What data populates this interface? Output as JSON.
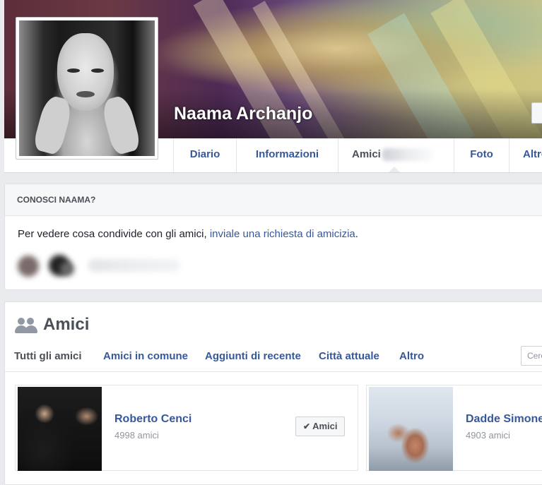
{
  "profile": {
    "name": "Naama Archanjo"
  },
  "tabs": [
    {
      "label": "Diario"
    },
    {
      "label": "Informazioni"
    },
    {
      "label": "Amici"
    },
    {
      "label": "Foto"
    },
    {
      "label": "Altro"
    }
  ],
  "conosci": {
    "heading": "CONOSCI NAAMA?",
    "text": "Per vedere cosa condivide con gli amici, ",
    "link": "inviale una richiesta di amicizia",
    "suffix": "."
  },
  "friends_section": {
    "title": "Amici",
    "subtabs": [
      {
        "label": "Tutti gli amici"
      },
      {
        "label": "Amici in comune"
      },
      {
        "label": "Aggiunti di recente"
      },
      {
        "label": "Città attuale"
      },
      {
        "label": "Altro"
      }
    ],
    "search_placeholder": "Cerca"
  },
  "friends": [
    {
      "name": "Roberto Cenci",
      "count": "4998 amici",
      "button": "Amici"
    },
    {
      "name": "Dadde Simone",
      "count": "4903 amici"
    }
  ],
  "icons": {
    "people": "people-icon",
    "check": "check-icon"
  },
  "colors": {
    "link": "#365899",
    "background": "#e9ebee",
    "text": "#4b4f56"
  }
}
